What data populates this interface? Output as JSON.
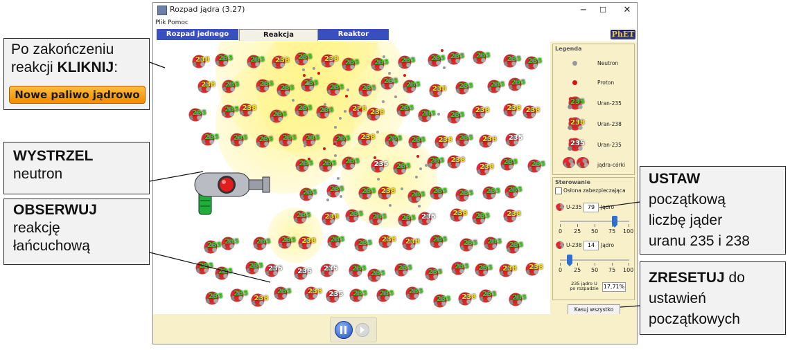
{
  "window": {
    "title": "Rozpad jądra (3.27)",
    "minimize": "−",
    "maximize": "☐",
    "close": "✕"
  },
  "menu": [
    "Plik",
    "Pomoc"
  ],
  "tabs": [
    "Rozpad jednego jądra",
    "Reakcja łańcuchowa",
    "Reaktor nuklearny"
  ],
  "active_tab": "Reakcja łańcuchowa",
  "logo": "PhET",
  "legend": {
    "title": "Legenda",
    "items": [
      "Neutron",
      "Proton",
      "Uran-235",
      "Uran-238",
      "Uran-235",
      "jądra-córki"
    ]
  },
  "controls": {
    "title": "Sterowanie",
    "shield_label": "Osłona zabezpieczająca",
    "u235_label": "U-235",
    "u235_value": "79",
    "u235_unit": "Jądro",
    "u235_fraction": 0.79,
    "u238_label": "U-238",
    "u238_value": "14",
    "u238_unit": "Jądro",
    "u238_fraction": 0.14,
    "ticks": [
      "0",
      "25",
      "50",
      "75",
      "100"
    ],
    "percent_caption": "235 jądro U po rozpadzie",
    "percent_value": "17,71%",
    "reset_button": "Kasuj wszystko"
  },
  "nucleus_labels": {
    "u235": "235",
    "u238": "238"
  },
  "callouts": {
    "finish": {
      "line1": "Po zakończeniu",
      "line2_pre": "reakcji ",
      "line2_bold": "KLIKNIJ",
      "line2_post": ":",
      "button": "Nowe paliwo jądrowo"
    },
    "fire": {
      "bold": "WYSTRZEL",
      "rest": "neutron"
    },
    "observe": {
      "bold": "OBSERWUJ",
      "line2": "reakcję",
      "line3": "łańcuchową"
    },
    "set": {
      "bold": "USTAW",
      "line2": "początkową",
      "line3": "liczbę jąder",
      "line4": "uranu 235 i 238"
    },
    "reset": {
      "bold": "ZRESETUJ",
      "line1_post": " do",
      "line2": "ustawień",
      "line3": "początkowych"
    }
  },
  "colors": {
    "tab_blue": "#3a4fbe",
    "panel_bg": "#f7f0c8",
    "u235_label": "#42d11c",
    "u238_label": "#ffe31a",
    "slider_thumb": "#2f6fd1"
  }
}
